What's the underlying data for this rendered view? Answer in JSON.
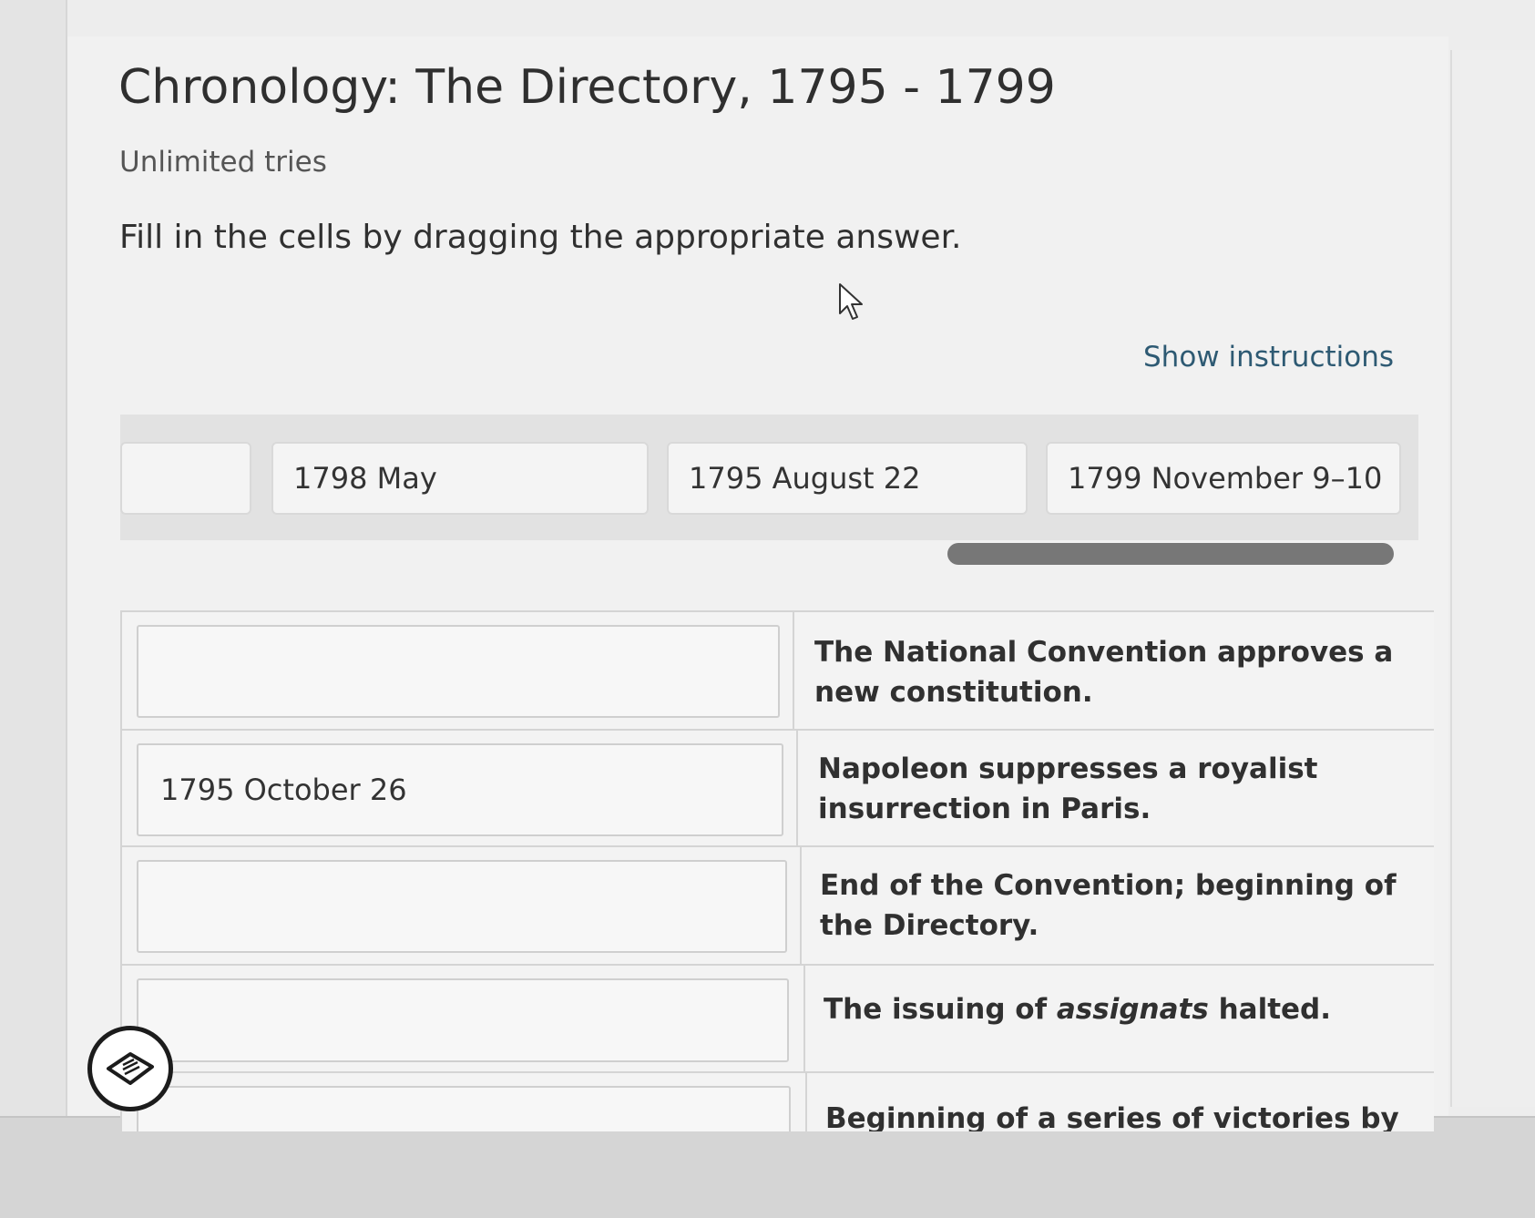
{
  "page": {
    "title": "Chronology: The Directory, 1795 - 1799",
    "tries": "Unlimited tries",
    "prompt": "Fill in the cells by dragging the appropriate answer.",
    "show_instructions": "Show instructions"
  },
  "answer_bank": {
    "chips": [
      "1798 May",
      "1795 August 22",
      "1799 November 9–10"
    ]
  },
  "table": {
    "rows": [
      {
        "answer": "",
        "event": "The National Convention approves a new constitution."
      },
      {
        "answer": "1795 October 26",
        "event": "Napoleon suppresses a royalist insurrection in Paris."
      },
      {
        "answer": "",
        "event": "End of the Convention; beginning of the Directory."
      },
      {
        "answer": "",
        "event_prefix": "The issuing of ",
        "event_italic": "assignats",
        "event_suffix": " halted."
      },
      {
        "answer": "",
        "event": "Beginning of a series of victories by"
      }
    ]
  },
  "icons": {
    "cursor": "arrow-cursor-icon",
    "fab": "notepad-icon"
  }
}
